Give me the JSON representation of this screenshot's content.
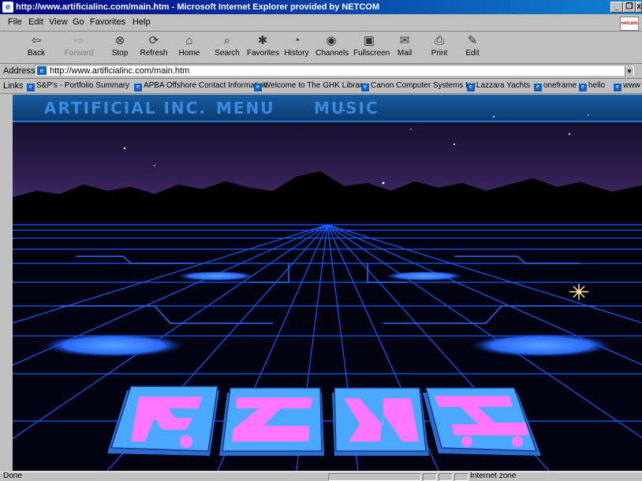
{
  "window": {
    "title": "http://www.artificialinc.com/main.htm - Microsoft Internet Explorer provided by NETCOM",
    "icon": "ie-page-icon",
    "controls": [
      "minimize-icon",
      "restore-icon",
      "close-icon"
    ]
  },
  "menu": {
    "items": [
      "File",
      "Edit",
      "View",
      "Go",
      "Favorites",
      "Help"
    ],
    "brand": "netcom"
  },
  "toolbar": {
    "buttons": [
      {
        "label": "Back",
        "icon": "back-arrow-icon"
      },
      {
        "label": "Forward",
        "icon": "forward-arrow-icon"
      },
      {
        "label": "Stop",
        "icon": "stop-icon"
      },
      {
        "label": "Refresh",
        "icon": "refresh-icon"
      },
      {
        "label": "Home",
        "icon": "home-icon"
      },
      {
        "label": "Search",
        "icon": "search-icon"
      },
      {
        "label": "Favorites",
        "icon": "favorites-icon"
      },
      {
        "label": "History",
        "icon": "history-icon"
      },
      {
        "label": "Channels",
        "icon": "channels-icon"
      },
      {
        "label": "Fullscreen",
        "icon": "fullscreen-icon"
      },
      {
        "label": "Mail",
        "icon": "mail-icon"
      },
      {
        "label": "Print",
        "icon": "print-icon"
      },
      {
        "label": "Edit",
        "icon": "edit-icon"
      }
    ]
  },
  "address": {
    "label": "Address",
    "url": "http://www.artificialinc.com/main.htm"
  },
  "links": {
    "label": "Links",
    "items": [
      "S&P's - Portfolio Summary",
      "APBA Offshore Contact Information",
      "Welcome to The GHK Library",
      "Canon Computer Systems Inc",
      "Lazzara Yachts",
      "oneframe",
      "hello",
      "www"
    ]
  },
  "page": {
    "nav": [
      "ARTIFICIAL INC.",
      "MENU",
      "MUSIC"
    ],
    "colors": {
      "sky": "#2b1a4a",
      "grid": "#1a5cff",
      "pad": "#3a7dff",
      "tile": "#4aa8ff",
      "glyph": "#ff78ff"
    }
  },
  "status": {
    "text": "Done",
    "zone": "Internet zone"
  }
}
